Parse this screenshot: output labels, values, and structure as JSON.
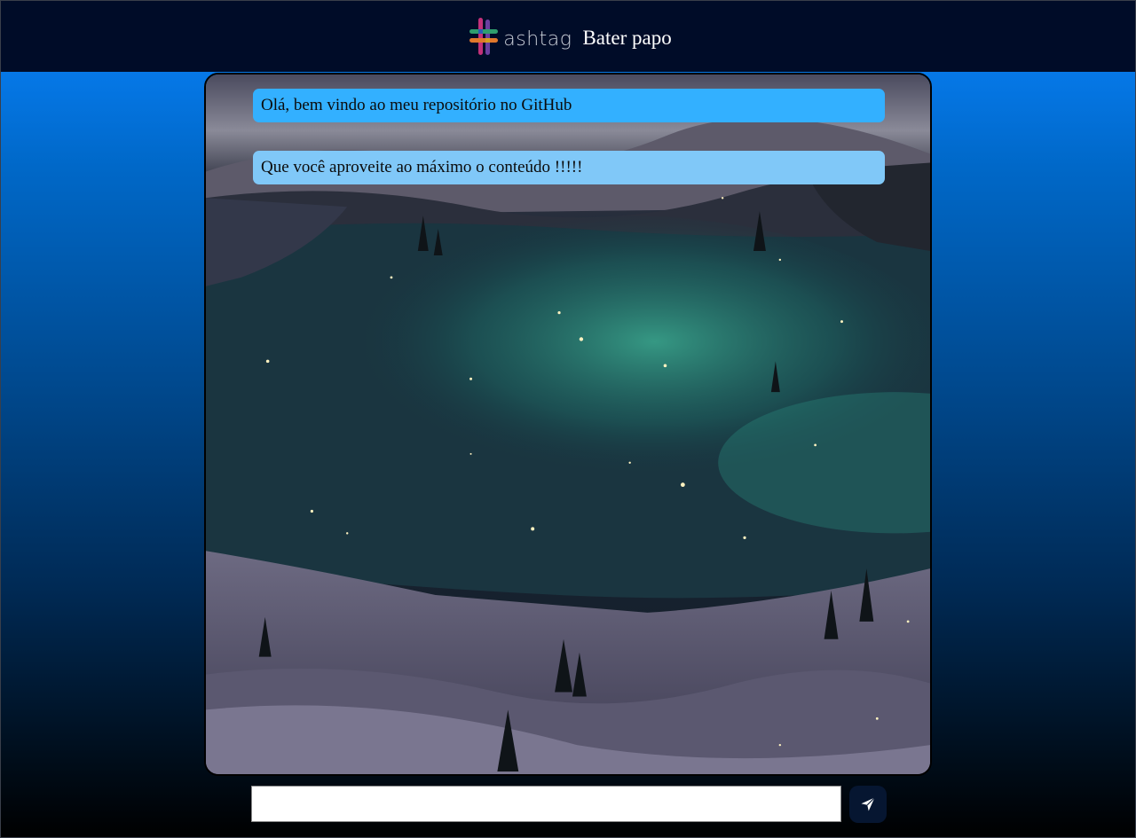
{
  "header": {
    "logo_text": "ashtag",
    "title": "Bater papo"
  },
  "chat": {
    "messages": [
      {
        "text": "Olá, bem vindo ao meu repositório no GitHub",
        "color": "#33b0ff"
      },
      {
        "text": "Que você aproveite ao máximo o conteúdo !!!!!",
        "color": "#80c8f8"
      }
    ],
    "background": "night-lake-aurora-landscape"
  },
  "composer": {
    "input_value": "",
    "input_placeholder": "",
    "send_icon": "paper-plane-icon"
  },
  "colors": {
    "header_bg": "#000c28",
    "page_gradient_top": "#0a84ff",
    "page_gradient_bottom": "#000000",
    "send_button_bg": "#061631"
  }
}
